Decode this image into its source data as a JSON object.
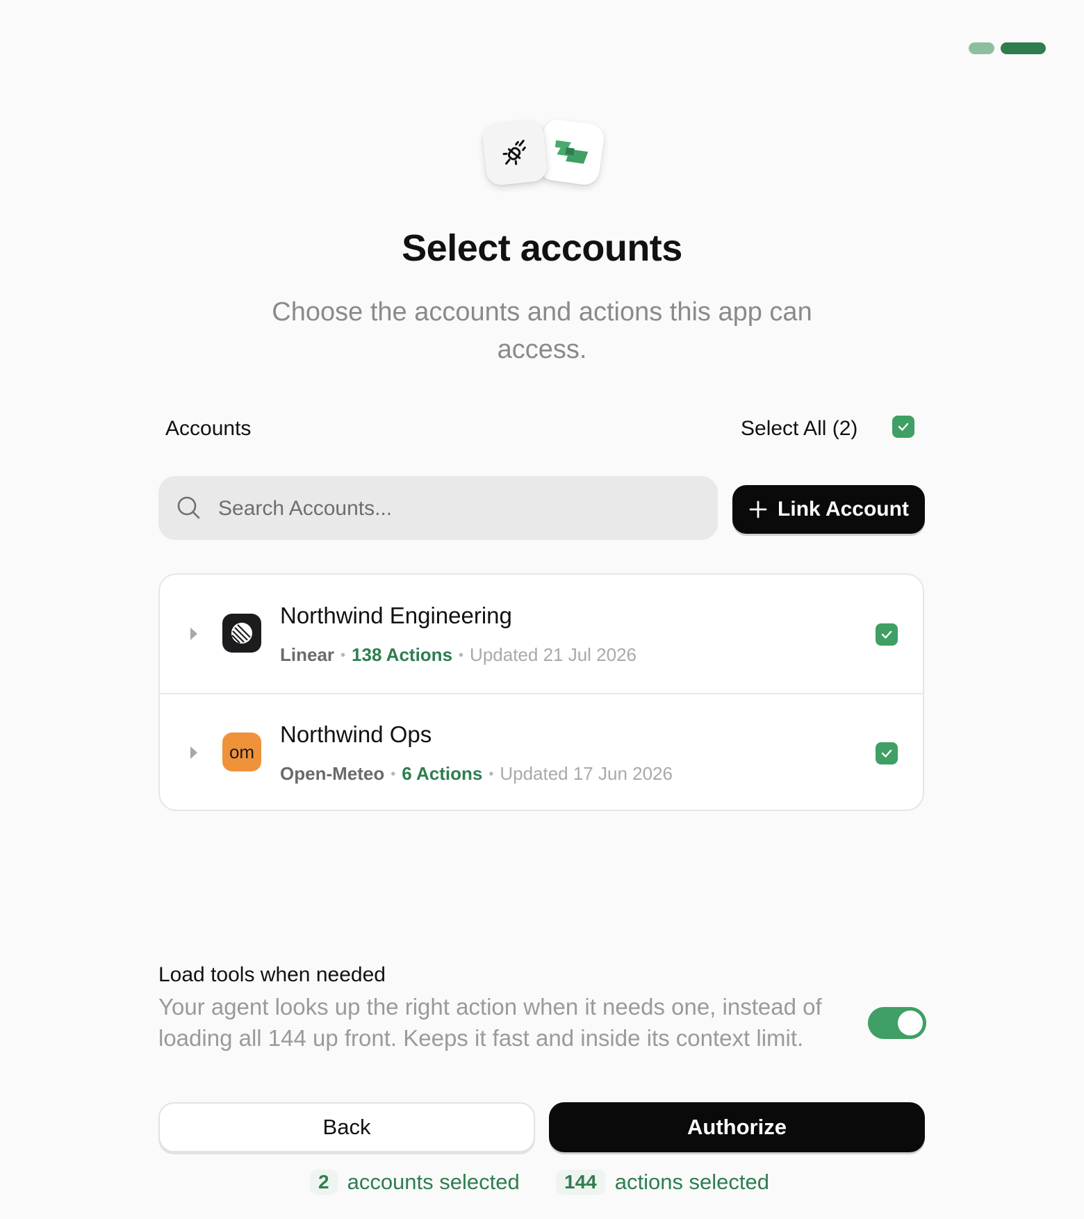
{
  "progress": {
    "steps": 2,
    "current": 2
  },
  "header": {
    "title": "Select accounts",
    "subtitle": "Choose the accounts and actions this app can access."
  },
  "accounts_section": {
    "label": "Accounts",
    "select_all_label": "Select All (2)",
    "select_all_checked": true
  },
  "search": {
    "placeholder": "Search Accounts..."
  },
  "link_account": {
    "label": "Link Account"
  },
  "accounts": [
    {
      "name": "Northwind Engineering",
      "provider": "Linear",
      "actions": "138 Actions",
      "updated": "Updated 21 Jul 2026",
      "checked": true,
      "logo": "linear-logo-icon"
    },
    {
      "name": "Northwind Ops",
      "provider": "Open-Meteo",
      "actions": "6 Actions",
      "updated": "Updated 17 Jun 2026",
      "checked": true,
      "logo_text": "om"
    }
  ],
  "lazy_load": {
    "title": "Load tools when needed",
    "description": "Your agent looks up the right action when it needs one, instead of loading all 144 up front. Keeps it fast and inside its context limit.",
    "enabled": true
  },
  "buttons": {
    "back": "Back",
    "authorize": "Authorize"
  },
  "summary": {
    "accounts_count": "2",
    "accounts_label": "accounts selected",
    "actions_count": "144",
    "actions_label": "actions selected"
  },
  "colors": {
    "accent": "#3f9f65",
    "accent_dark": "#2f7d4f",
    "primary_button": "#0a0a0a"
  }
}
